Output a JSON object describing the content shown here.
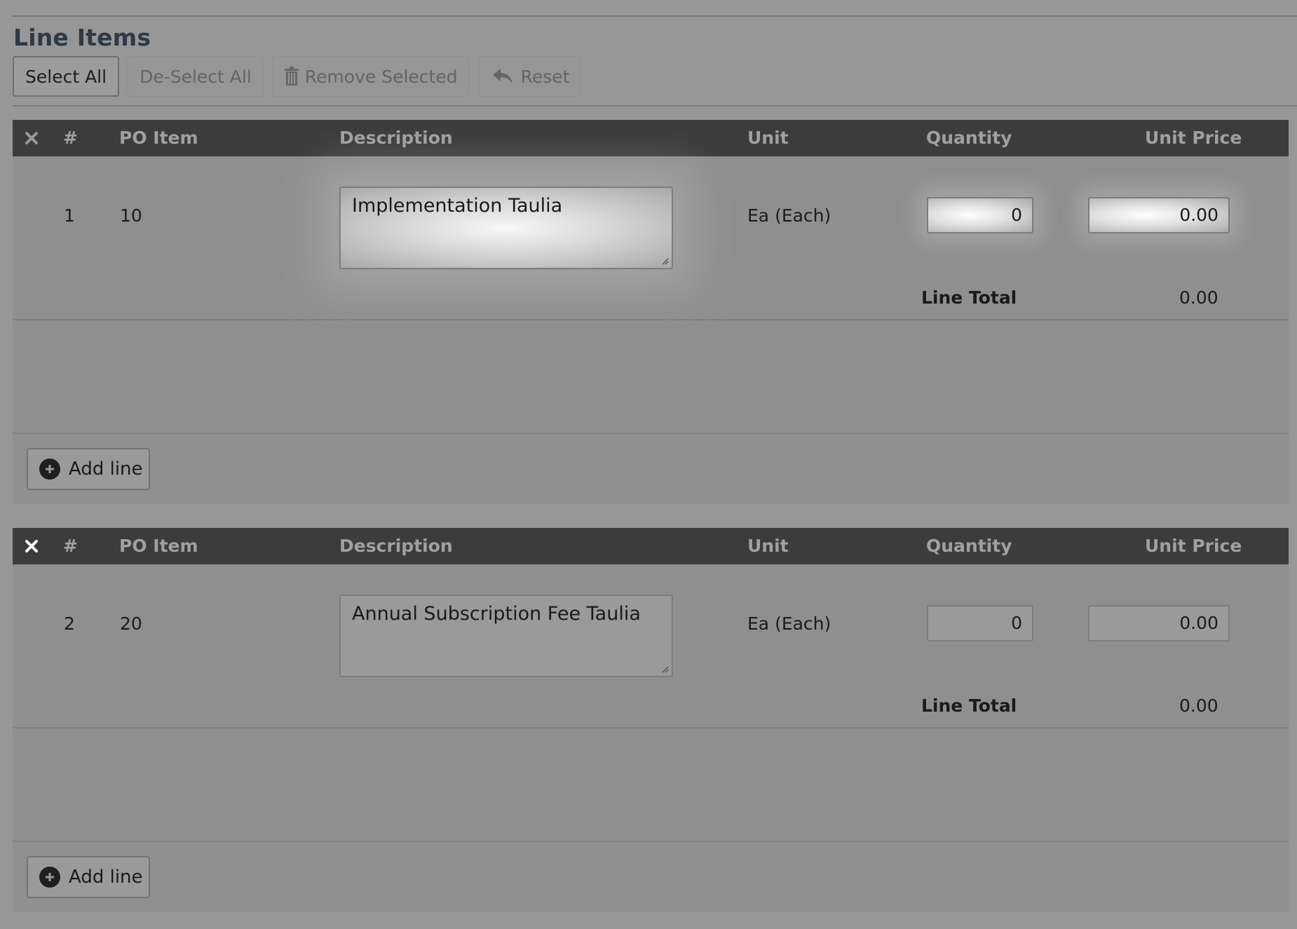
{
  "section": {
    "title": "Line Items"
  },
  "toolbar": {
    "select_all": "Select All",
    "deselect_all": "De-Select All",
    "remove_selected": "Remove Selected",
    "reset": "Reset"
  },
  "columns": {
    "number": "#",
    "po_item": "PO Item",
    "description": "Description",
    "unit": "Unit",
    "quantity": "Quantity",
    "unit_price": "Unit Price"
  },
  "line_items": [
    {
      "number": "1",
      "po_item": "10",
      "description": "Implementation Taulia",
      "unit": "Ea (Each)",
      "quantity": "0",
      "unit_price": "0.00",
      "line_total_label": "Line Total",
      "line_total": "0.00"
    },
    {
      "number": "2",
      "po_item": "20",
      "description": "Annual Subscription Fee Taulia",
      "unit": "Ea (Each)",
      "quantity": "0",
      "unit_price": "0.00",
      "line_total_label": "Line Total",
      "line_total": "0.00"
    }
  ],
  "add_line_label": "Add line",
  "icons": {
    "trash": "trash-icon",
    "reset": "reply-arrow-icon",
    "remove_column": "close-icon",
    "add": "plus-circle-icon"
  },
  "colors": {
    "header_bg": "#3c3c3c",
    "page_bg": "#979797",
    "title": "#2e3a45"
  }
}
